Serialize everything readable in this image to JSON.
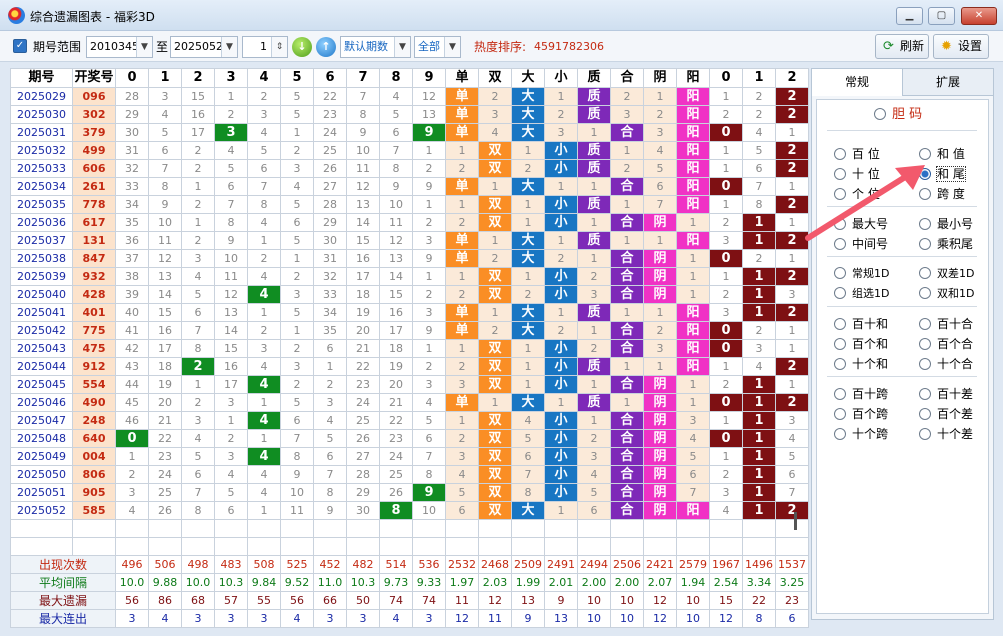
{
  "window": {
    "title": "综合遗漏图表 - 福彩3D"
  },
  "toolbar": {
    "range_label": "期号范围",
    "from": "2010345",
    "to_label": "至",
    "to": "2025052",
    "step": "1",
    "mode": "默认期数",
    "filter": "全部",
    "heat_label": "热度排序:",
    "heat_value": "4591782306",
    "refresh": "刷新",
    "settings": "设置"
  },
  "table": {
    "headers": [
      "期号",
      "开奖号",
      "0",
      "1",
      "2",
      "3",
      "4",
      "5",
      "6",
      "7",
      "8",
      "9",
      "单",
      "双",
      "大",
      "小",
      "质",
      "合",
      "阴",
      "阳",
      "0",
      "1",
      "2"
    ],
    "rows": [
      {
        "p": "2025029",
        "n": "096",
        "c": [
          "28",
          "3",
          "15",
          "1",
          "2",
          "5",
          "22",
          "7",
          "4",
          "12",
          "单",
          "2",
          "大",
          "1",
          "质",
          "2",
          "1",
          "阳",
          "1",
          "2",
          "2"
        ]
      },
      {
        "p": "2025030",
        "n": "302",
        "c": [
          "29",
          "4",
          "16",
          "2",
          "3",
          "5",
          "23",
          "8",
          "5",
          "13",
          "单",
          "3",
          "大",
          "2",
          "质",
          "3",
          "2",
          "阳",
          "2",
          "2",
          "2"
        ]
      },
      {
        "p": "2025031",
        "n": "379",
        "c": [
          "30",
          "5",
          "17",
          "3",
          "4",
          "1",
          "24",
          "9",
          "6",
          "9",
          "单",
          "4",
          "大",
          "3",
          "1",
          "合",
          "3",
          "阳",
          "0",
          "4",
          "1"
        ]
      },
      {
        "p": "2025032",
        "n": "499",
        "c": [
          "31",
          "6",
          "2",
          "4",
          "5",
          "2",
          "25",
          "10",
          "7",
          "1",
          "1",
          "双",
          "1",
          "小",
          "质",
          "1",
          "4",
          "阳",
          "1",
          "5",
          "2"
        ]
      },
      {
        "p": "2025033",
        "n": "606",
        "c": [
          "32",
          "7",
          "2",
          "5",
          "6",
          "3",
          "26",
          "11",
          "8",
          "2",
          "2",
          "双",
          "2",
          "小",
          "质",
          "2",
          "5",
          "阳",
          "1",
          "6",
          "2"
        ]
      },
      {
        "p": "2025034",
        "n": "261",
        "c": [
          "33",
          "8",
          "1",
          "6",
          "7",
          "4",
          "27",
          "12",
          "9",
          "9",
          "单",
          "1",
          "大",
          "1",
          "1",
          "合",
          "6",
          "阳",
          "0",
          "7",
          "1"
        ]
      },
      {
        "p": "2025035",
        "n": "778",
        "c": [
          "34",
          "9",
          "2",
          "7",
          "8",
          "5",
          "28",
          "13",
          "10",
          "1",
          "1",
          "双",
          "1",
          "小",
          "质",
          "1",
          "7",
          "阳",
          "1",
          "8",
          "2"
        ]
      },
      {
        "p": "2025036",
        "n": "617",
        "c": [
          "35",
          "10",
          "1",
          "8",
          "4",
          "6",
          "29",
          "14",
          "11",
          "2",
          "2",
          "双",
          "1",
          "小",
          "1",
          "合",
          "阴",
          "1",
          "2",
          "1",
          "1"
        ]
      },
      {
        "p": "2025037",
        "n": "131",
        "c": [
          "36",
          "11",
          "2",
          "9",
          "1",
          "5",
          "30",
          "15",
          "12",
          "3",
          "单",
          "1",
          "大",
          "1",
          "质",
          "1",
          "1",
          "阳",
          "3",
          "1",
          "2"
        ]
      },
      {
        "p": "2025038",
        "n": "847",
        "c": [
          "37",
          "12",
          "3",
          "10",
          "2",
          "1",
          "31",
          "16",
          "13",
          "9",
          "单",
          "2",
          "大",
          "2",
          "1",
          "合",
          "阴",
          "1",
          "0",
          "2",
          "1"
        ]
      },
      {
        "p": "2025039",
        "n": "932",
        "c": [
          "38",
          "13",
          "4",
          "11",
          "4",
          "2",
          "32",
          "17",
          "14",
          "1",
          "1",
          "双",
          "1",
          "小",
          "2",
          "合",
          "阴",
          "1",
          "1",
          "1",
          "2"
        ]
      },
      {
        "p": "2025040",
        "n": "428",
        "c": [
          "39",
          "14",
          "5",
          "12",
          "4",
          "3",
          "33",
          "18",
          "15",
          "2",
          "2",
          "双",
          "2",
          "小",
          "3",
          "合",
          "阴",
          "1",
          "2",
          "1",
          "3"
        ]
      },
      {
        "p": "2025041",
        "n": "401",
        "c": [
          "40",
          "15",
          "6",
          "13",
          "1",
          "5",
          "34",
          "19",
          "16",
          "3",
          "单",
          "1",
          "大",
          "1",
          "质",
          "1",
          "1",
          "阳",
          "3",
          "1",
          "2"
        ]
      },
      {
        "p": "2025042",
        "n": "775",
        "c": [
          "41",
          "16",
          "7",
          "14",
          "2",
          "1",
          "35",
          "20",
          "17",
          "9",
          "单",
          "2",
          "大",
          "2",
          "1",
          "合",
          "2",
          "阳",
          "0",
          "2",
          "1"
        ]
      },
      {
        "p": "2025043",
        "n": "475",
        "c": [
          "42",
          "17",
          "8",
          "15",
          "3",
          "2",
          "6",
          "21",
          "18",
          "1",
          "1",
          "双",
          "1",
          "小",
          "2",
          "合",
          "3",
          "阳",
          "0",
          "3",
          "1"
        ]
      },
      {
        "p": "2025044",
        "n": "912",
        "c": [
          "43",
          "18",
          "2",
          "16",
          "4",
          "3",
          "1",
          "22",
          "19",
          "2",
          "2",
          "双",
          "1",
          "小",
          "质",
          "1",
          "1",
          "阳",
          "1",
          "4",
          "2"
        ]
      },
      {
        "p": "2025045",
        "n": "554",
        "c": [
          "44",
          "19",
          "1",
          "17",
          "4",
          "2",
          "2",
          "23",
          "20",
          "3",
          "3",
          "双",
          "1",
          "小",
          "1",
          "合",
          "阴",
          "1",
          "2",
          "1",
          "1"
        ]
      },
      {
        "p": "2025046",
        "n": "490",
        "c": [
          "45",
          "20",
          "2",
          "3",
          "1",
          "5",
          "3",
          "24",
          "21",
          "4",
          "单",
          "1",
          "大",
          "1",
          "质",
          "1",
          "阴",
          "1",
          "0",
          "1",
          "2"
        ]
      },
      {
        "p": "2025047",
        "n": "248",
        "c": [
          "46",
          "21",
          "3",
          "1",
          "4",
          "6",
          "4",
          "25",
          "22",
          "5",
          "1",
          "双",
          "4",
          "小",
          "1",
          "合",
          "阴",
          "3",
          "1",
          "1",
          "3"
        ]
      },
      {
        "p": "2025048",
        "n": "640",
        "c": [
          "0",
          "22",
          "4",
          "2",
          "1",
          "7",
          "5",
          "26",
          "23",
          "6",
          "2",
          "双",
          "5",
          "小",
          "2",
          "合",
          "阴",
          "4",
          "0",
          "1",
          "4"
        ]
      },
      {
        "p": "2025049",
        "n": "004",
        "c": [
          "1",
          "23",
          "5",
          "3",
          "4",
          "8",
          "6",
          "27",
          "24",
          "7",
          "3",
          "双",
          "6",
          "小",
          "3",
          "合",
          "阴",
          "5",
          "1",
          "1",
          "5"
        ]
      },
      {
        "p": "2025050",
        "n": "806",
        "c": [
          "2",
          "24",
          "6",
          "4",
          "4",
          "9",
          "7",
          "28",
          "25",
          "8",
          "4",
          "双",
          "7",
          "小",
          "4",
          "合",
          "阴",
          "6",
          "2",
          "1",
          "6"
        ]
      },
      {
        "p": "2025051",
        "n": "905",
        "c": [
          "3",
          "25",
          "7",
          "5",
          "4",
          "10",
          "8",
          "29",
          "26",
          "9",
          "5",
          "双",
          "8",
          "小",
          "5",
          "合",
          "阴",
          "7",
          "3",
          "1",
          "7"
        ]
      },
      {
        "p": "2025052",
        "n": "585",
        "c": [
          "4",
          "26",
          "8",
          "6",
          "1",
          "11",
          "9",
          "30",
          "8",
          "10",
          "6",
          "双",
          "大",
          "1",
          "6",
          "合",
          "阴",
          "阳",
          "4",
          "1",
          "2"
        ]
      }
    ],
    "stats": [
      {
        "label": "出现次数",
        "v": [
          "496",
          "506",
          "498",
          "483",
          "508",
          "525",
          "452",
          "482",
          "514",
          "536",
          "2532",
          "2468",
          "2509",
          "2491",
          "2494",
          "2506",
          "2421",
          "2579",
          "1967",
          "1496",
          "1537"
        ]
      },
      {
        "label": "平均间隔",
        "v": [
          "10.0",
          "9.88",
          "10.0",
          "10.3",
          "9.84",
          "9.52",
          "11.0",
          "10.3",
          "9.73",
          "9.33",
          "1.97",
          "2.03",
          "1.99",
          "2.01",
          "2.00",
          "2.00",
          "2.07",
          "1.94",
          "2.54",
          "3.34",
          "3.25"
        ]
      },
      {
        "label": "最大遗漏",
        "v": [
          "56",
          "86",
          "68",
          "57",
          "55",
          "56",
          "66",
          "50",
          "74",
          "74",
          "11",
          "12",
          "13",
          "9",
          "10",
          "10",
          "12",
          "10",
          "15",
          "22",
          "23"
        ]
      },
      {
        "label": "最大连出",
        "v": [
          "3",
          "4",
          "3",
          "3",
          "3",
          "4",
          "3",
          "3",
          "4",
          "3",
          "12",
          "11",
          "9",
          "13",
          "10",
          "10",
          "12",
          "10",
          "12",
          "8",
          "6"
        ]
      }
    ]
  },
  "side": {
    "tabs": [
      "常规",
      "扩展"
    ],
    "top": "胆 码",
    "options": [
      [
        "百 位",
        "和 值"
      ],
      [
        "十 位",
        "和 尾"
      ],
      [
        "个 位",
        "跨 度"
      ],
      [
        "最大号",
        "最小号"
      ],
      [
        "中间号",
        "乘积尾"
      ],
      [
        "常规1D",
        "双差1D"
      ],
      [
        "组选1D",
        "双和1D"
      ],
      [
        "百十和",
        "百十合"
      ],
      [
        "百个和",
        "百个合"
      ],
      [
        "十个和",
        "十个合"
      ],
      [
        "百十跨",
        "百十差"
      ],
      [
        "百个跨",
        "百个差"
      ],
      [
        "十个跨",
        "十个差"
      ]
    ],
    "selected": "和 尾"
  }
}
